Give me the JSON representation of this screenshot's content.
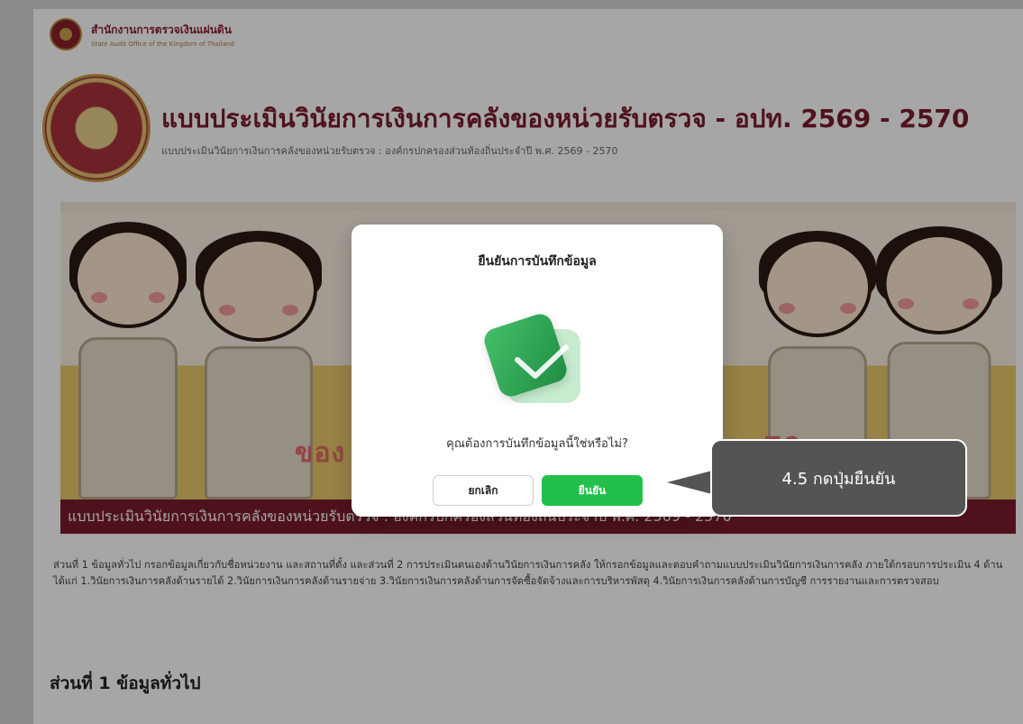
{
  "header": {
    "org_name_th": "สำนักงานการตรวจเงินแผ่นดิน",
    "org_name_en": "State Audit Office of the Kingdom of Thailand"
  },
  "page": {
    "title": "แบบประเมินวินัยการเงินการคลังของหน่วยรับตรวจ - อปท. 2569 - 2570",
    "subtitle": "แบบประเมินวินัยการเงินการคลังของหน่วยรับตรวจ : องค์กรปกครองส่วนท้องถิ่นประจำปี พ.ศ. 2569 - 2570",
    "banner_text_left": "ของ",
    "banner_text_right": "70",
    "banner_bar_text": "แบบประเมินวินัยการเงินการคลังของหน่วยรับตรวจ : องค์กรปกครองส่วนท้องถิ่นประจำปี พ.ศ. 2569 - 2570",
    "description": "ส่วนที่ 1 ข้อมูลทั่วไป กรอกข้อมูลเกี่ยวกับชื่อหน่วยงาน และสถานที่ตั้ง และส่วนที่ 2 การประเมินตนเองด้านวินัยการเงินการคลัง ให้กรอกข้อมูลและตอบคำถามแบบประเมินวินัยการเงินการคลัง ภายใต้กรอบการประเมิน 4 ด้าน ได้แก่ 1.วินัยการเงินการคลังด้านรายได้ 2.วินัยการเงินการคลังด้านรายจ่าย 3.วินัยการเงินการคลังด้านการจัดซื้อจัดจ้างและการบริหารพัสดุ 4.วินัยการเงินการคลังด้านการบัญชี การรายงานและการตรวจสอบ",
    "section_title": "ส่วนที่ 1 ข้อมูลทั่วไป"
  },
  "modal": {
    "title": "ยืนยันการบันทึกข้อมูล",
    "question": "คุณต้องการบันทึกข้อมูลนี้ใช่หรือไม่?",
    "cancel_label": "ยกเลิก",
    "confirm_label": "ยืนยัน",
    "icon": "check-icon"
  },
  "callout": {
    "text": "4.5 กดปุ่มยืนยัน"
  },
  "colors": {
    "brand": "#7a1c2c",
    "confirm": "#22c04a",
    "callout": "#545454"
  }
}
